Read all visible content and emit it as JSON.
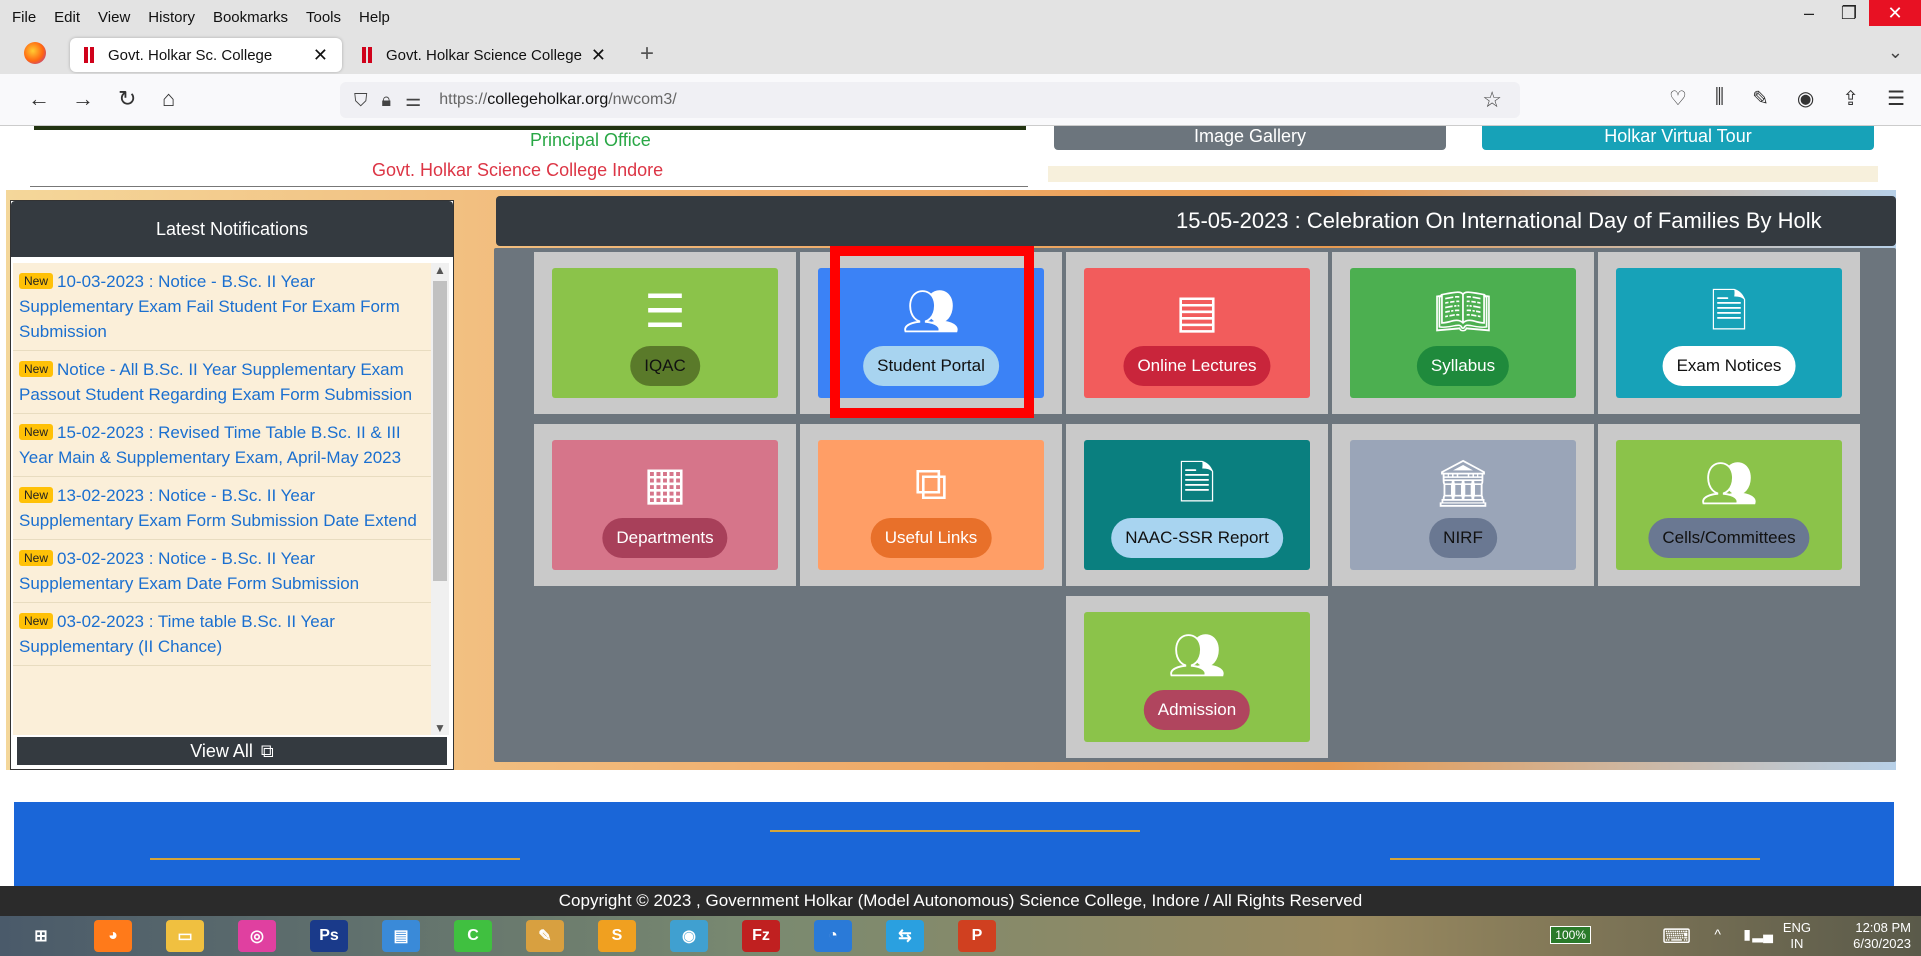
{
  "menubar": {
    "items": [
      "File",
      "Edit",
      "View",
      "History",
      "Bookmarks",
      "Tools",
      "Help"
    ]
  },
  "tabs": [
    {
      "title": "Govt. Holkar Sc. College",
      "active": true
    },
    {
      "title": "Govt. Holkar Science College",
      "active": false
    }
  ],
  "address": {
    "scheme": "https://",
    "host": "collegeholkar.org",
    "path": "/nwcom3/"
  },
  "header": {
    "principal": "Principal Office",
    "college": "Govt. Holkar Science College Indore",
    "gallery_label": "Image Gallery",
    "tour_label": "Holkar Virtual Tour"
  },
  "notifications": {
    "title": "Latest Notifications",
    "badge": "New",
    "items": [
      "10-03-2023 : Notice - B.Sc. II Year Supplementary Exam Fail Student For Exam Form Submission",
      "Notice - All B.Sc. II Year Supplementary Exam Passout Student Regarding Exam Form Submission",
      "15-02-2023 : Revised Time Table B.Sc. II & III Year Main & Supplementary Exam, April-May 2023",
      "13-02-2023 : Notice - B.Sc. II Year Supplementary Exam Form Submission Date Extend",
      "03-02-2023 : Notice - B.Sc. II Year Supplementary Exam Date Form Submission",
      "03-02-2023 : Time table B.Sc. II Year Supplementary (II Chance)"
    ],
    "view_all": "View All"
  },
  "marquee": "15-05-2023 : Celebration On International Day of Families By Holk",
  "tiles": [
    {
      "label": "IQAC",
      "icon": "list-ol-icon",
      "color": "#8bc34a",
      "pill": "#5a7a2a",
      "pill_text": "#111"
    },
    {
      "label": "Student Portal",
      "icon": "users-icon",
      "color": "#3b82f6",
      "pill": "#a8d4f0",
      "pill_text": "#111"
    },
    {
      "label": "Online Lectures",
      "icon": "book-icon",
      "color": "#f25c5c",
      "pill": "#c9253b",
      "pill_text": "#fff"
    },
    {
      "label": "Syllabus",
      "icon": "reader-icon",
      "color": "#4caf50",
      "pill": "#1f8a3c",
      "pill_text": "#fff"
    },
    {
      "label": "Exam Notices",
      "icon": "file-icon",
      "color": "#17a2b8",
      "pill": "#ffffff",
      "pill_text": "#111"
    },
    {
      "label": "Departments",
      "icon": "building-icon",
      "color": "#d6758a",
      "pill": "#a8405a",
      "pill_text": "#fff"
    },
    {
      "label": "Useful Links",
      "icon": "external-link-icon",
      "color": "#ff9e66",
      "pill": "#e8702a",
      "pill_text": "#fff"
    },
    {
      "label": "NAAC-SSR Report",
      "icon": "file-icon",
      "color": "#0a7f7f",
      "pill": "#a8d4f0",
      "pill_text": "#111"
    },
    {
      "label": "NIRF",
      "icon": "bank-icon",
      "color": "#9aa5b8",
      "pill": "#6a7892",
      "pill_text": "#111"
    },
    {
      "label": "Cells/Committees",
      "icon": "users-icon",
      "color": "#8bc34a",
      "pill": "#6a7892",
      "pill_text": "#111"
    },
    {
      "label": "Admission",
      "icon": "users-icon",
      "color": "#8bc34a",
      "pill": "#b0455e",
      "pill_text": "#fff"
    }
  ],
  "footer": {
    "copyright": "Copyright © 2023 , Government Holkar (Model Autonomous) Science College, Indore / All Rights Reserved"
  },
  "taskbar": {
    "apps": [
      "windows-start-icon",
      "firefox-icon",
      "file-explorer-icon",
      "paint-icon",
      "photoshop-icon",
      "system-icon",
      "camtasia-icon",
      "paint-palette-icon",
      "sublime-icon",
      "earth-icon",
      "filezilla-icon",
      "thunderbird-icon",
      "connect-icon",
      "powerpoint-icon"
    ],
    "battery": "100%",
    "lang_top": "ENG",
    "lang_bottom": "IN",
    "time": "12:08 PM",
    "date": "6/30/2023"
  }
}
